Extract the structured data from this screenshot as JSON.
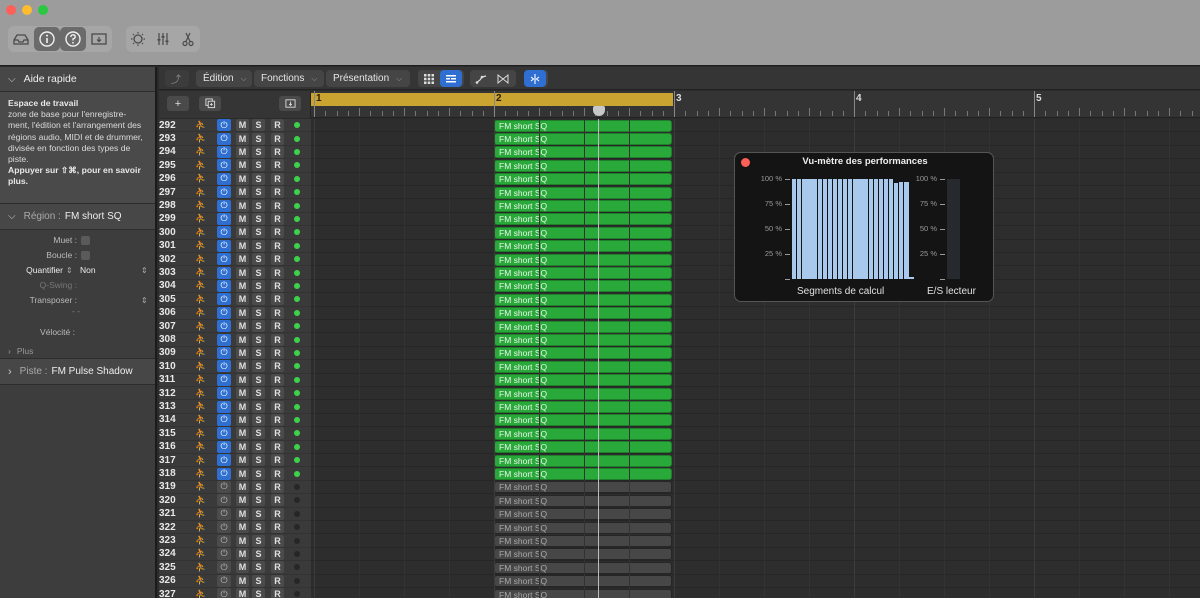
{
  "window": {
    "toolbar": {
      "left_group": [
        "library-icon",
        "info-icon",
        "help-icon",
        "download-icon"
      ],
      "right_group": [
        "brightness-icon",
        "mixer-icon",
        "scissors-icon"
      ]
    }
  },
  "inspector": {
    "quick_help": {
      "header": "Aide rapide",
      "title": "Espace de travail",
      "body": "zone de base pour l'enregistre-ment, l'édition et l'arrangement des régions audio, MIDI et de drummer, divisée en fonction des types de piste.",
      "footer": "Appuyer sur ⇧⌘, pour en savoir plus."
    },
    "region": {
      "label": "Région :",
      "name": "FM short SQ",
      "props": {
        "mute_label": "Muet :",
        "loop_label": "Boucle :",
        "quantize_label": "Quantifier",
        "quantize_value": "Non",
        "qswing_label": "Q-Swing :",
        "transpose_label": "Transposer :",
        "transpose_value": "- -",
        "velocity_label": "Vélocité :"
      },
      "more_label": "Plus"
    },
    "track": {
      "label": "Piste :",
      "name": "FM Pulse Shadow"
    }
  },
  "main_toolbar": {
    "menus": [
      "Édition",
      "Fonctions",
      "Présentation"
    ]
  },
  "ruler": {
    "bars": [
      "1",
      "2",
      "3",
      "4",
      "5"
    ],
    "cycle_range": [
      1,
      3
    ]
  },
  "track_buttons": {
    "mute": "M",
    "solo": "S",
    "record": "R"
  },
  "tracks": {
    "first_number": 292,
    "last_number": 327,
    "active_until": 318,
    "region_name": "FM short SQ"
  },
  "performance_meter": {
    "title": "Vu-mètre des performances",
    "labels": {
      "segments": "Segments de calcul",
      "io": "E/S lecteur"
    },
    "y_ticks": [
      "100 %",
      "75 %",
      "50 %",
      "25 %",
      ""
    ]
  },
  "chart_data": {
    "type": "bar",
    "title": "Vu-mètre des performances",
    "series": [
      {
        "name": "Segments de calcul",
        "values": [
          100,
          100,
          100,
          100,
          100,
          100,
          100,
          100,
          100,
          100,
          100,
          100,
          100,
          100,
          100,
          100,
          100,
          100,
          100,
          100,
          96,
          97,
          97,
          2
        ]
      },
      {
        "name": "E/S lecteur",
        "values": [
          0
        ]
      }
    ],
    "ylim": [
      0,
      100
    ],
    "yticks": [
      "25 %",
      "50 %",
      "75 %",
      "100 %"
    ]
  }
}
